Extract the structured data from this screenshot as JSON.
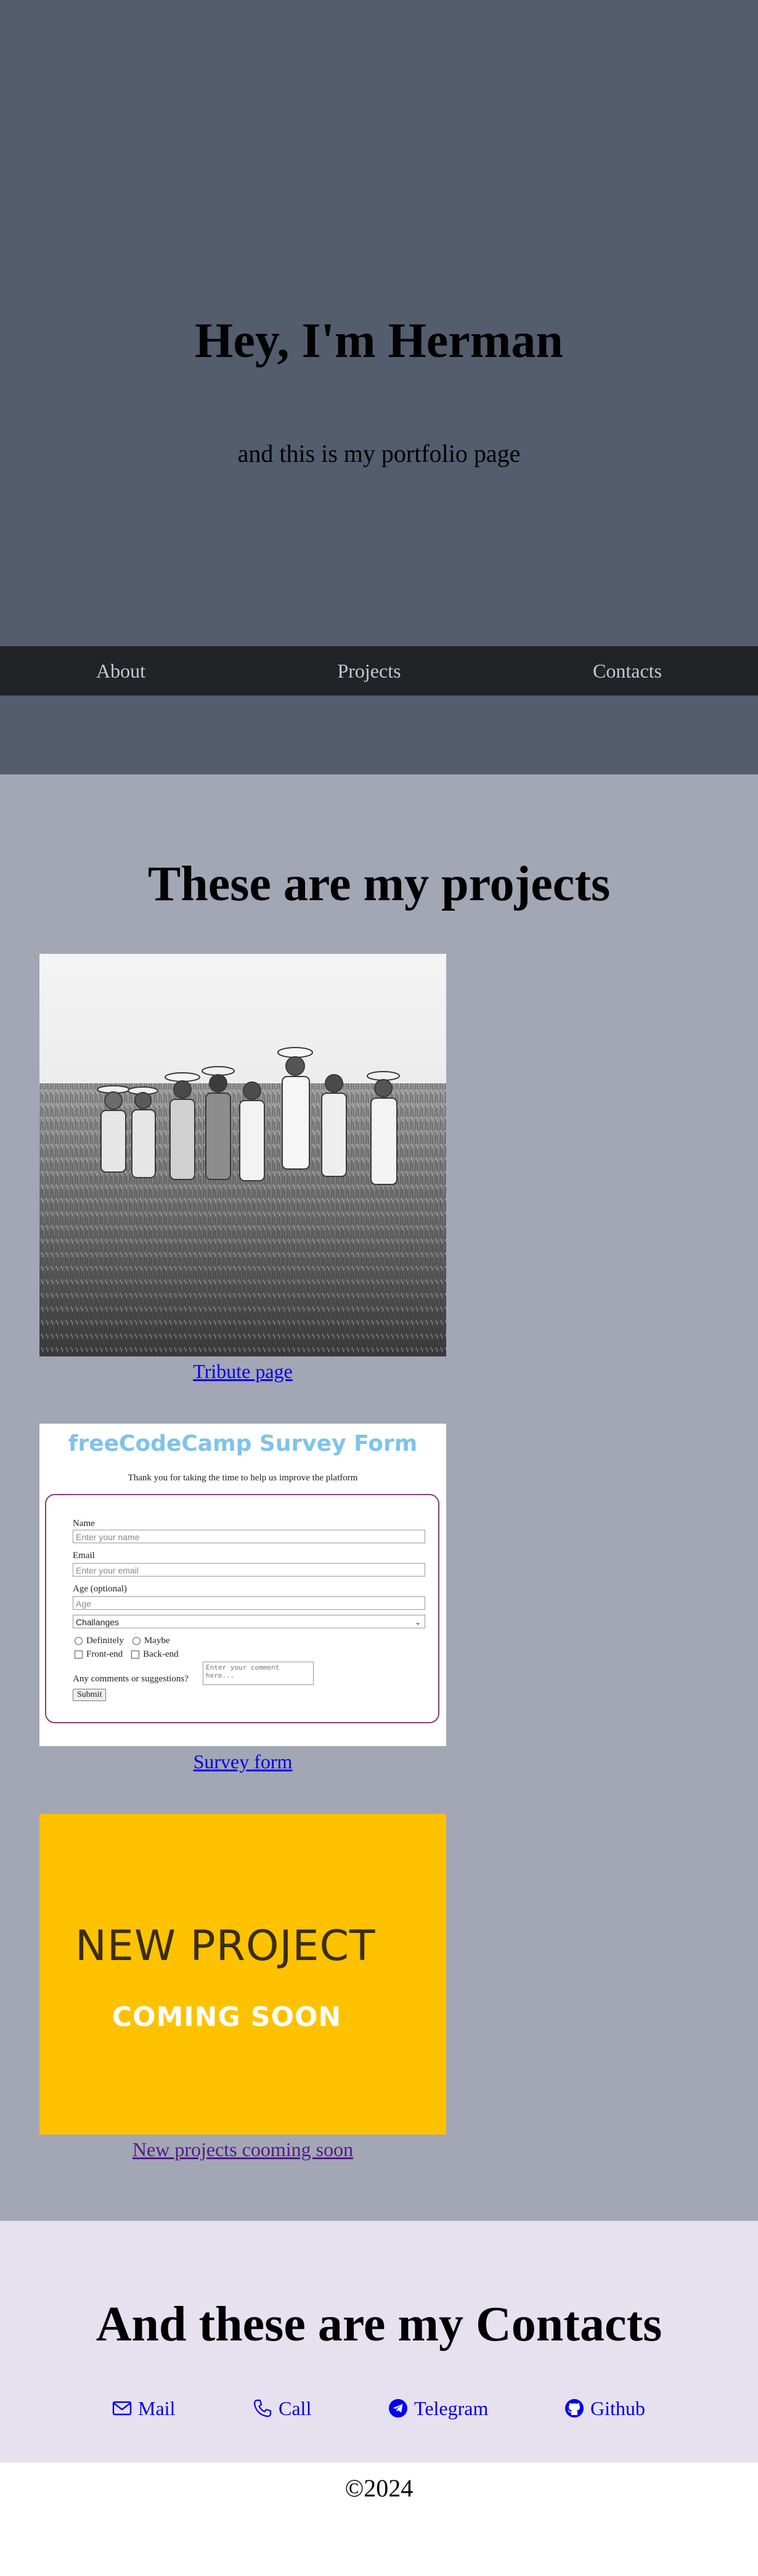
{
  "welcome": {
    "heading": "Hey, I'm Herman",
    "subheading": "and this is my portfolio page"
  },
  "nav": {
    "about": "About",
    "projects": "Projects",
    "contacts": "Contacts"
  },
  "projects": {
    "heading": "These are my projects",
    "items": [
      {
        "caption": "Tribute page",
        "image_icon": "tribute-photo"
      },
      {
        "caption": "Survey form",
        "image_icon": "survey-form-screenshot"
      },
      {
        "caption": "New projects cooming soon",
        "image_icon": "coming-soon-banner"
      }
    ]
  },
  "survey_preview": {
    "title": "freeCodeCamp Survey Form",
    "description": "Thank you for taking the time to help us improve the platform",
    "name_label": "Name",
    "name_placeholder": "Enter your name",
    "email_label": "Email",
    "email_placeholder": "Enter your email",
    "age_label": "Age (optional)",
    "age_placeholder": "Age",
    "select_value": "Challanges",
    "radio_1": "Definitely",
    "radio_2": "Maybe",
    "check_1": "Front-end",
    "check_2": "Back-end",
    "comments_label": "Any comments or suggestions?",
    "comments_placeholder": "Enter your comment here...",
    "submit_label": "Submit"
  },
  "coming_soon": {
    "line1": "NEW PROJECT",
    "line2": "COMING SOON"
  },
  "contacts": {
    "heading": "And these are my Contacts",
    "items": [
      {
        "label": "Mail",
        "icon": "envelope-icon"
      },
      {
        "label": "Call",
        "icon": "phone-icon"
      },
      {
        "label": "Telegram",
        "icon": "telegram-icon"
      },
      {
        "label": "Github",
        "icon": "github-icon"
      }
    ]
  },
  "footer": {
    "copyright": "©2024"
  },
  "colors": {
    "welcome_bg": "#535d6d",
    "navbar_bg": "#222326",
    "projects_bg": "#a3a6b5",
    "contacts_bg": "#e7e0ef",
    "link_blue": "#0000ee",
    "link_visited": "#551a8b",
    "coming_soon_yellow": "#fec200"
  }
}
